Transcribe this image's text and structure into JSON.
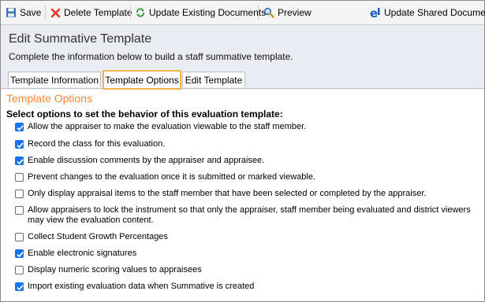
{
  "toolbar": {
    "save": "Save",
    "delete": "Delete Template",
    "update_docs": "Update Existing Documents",
    "preview": "Preview",
    "update_shared": "Update Shared Document"
  },
  "header": {
    "title": "Edit Summative Template",
    "subtitle": "Complete the information below to build a staff summative template."
  },
  "tabs": [
    {
      "label": "Template Information",
      "active": false
    },
    {
      "label": "Template Options",
      "active": true
    },
    {
      "label": "Edit Template",
      "active": false
    }
  ],
  "section": {
    "title": "Template Options",
    "instructions": "Select options to set the behavior of this evaluation template:"
  },
  "options": [
    {
      "label": "Allow the appraiser to make the evaluation viewable to the staff member.",
      "checked": true
    },
    {
      "label": "Record the class for this evaluation.",
      "checked": true
    },
    {
      "label": "Enable discussion comments by the appraiser and appraisee.",
      "checked": true
    },
    {
      "label": "Prevent changes to the evaluation once it is submitted or marked viewable.",
      "checked": false
    },
    {
      "label": "Only display appraisal items to the staff member that have been selected or completed by the appraiser.",
      "checked": false
    },
    {
      "label": "Allow appraisers to lock the instrument so that only the appraiser, staff member being evaluated and district viewers may view the evaluation content.",
      "checked": false
    },
    {
      "label": "Collect Student Growth Percentages",
      "checked": false
    },
    {
      "label": "Enable electronic signatures",
      "checked": true
    },
    {
      "label": "Display numeric scoring values to appraisees",
      "checked": false
    },
    {
      "label": "Import existing evaluation data when Summative is created",
      "checked": true
    }
  ],
  "colors": {
    "accent_tab_border": "#f0b44a",
    "section_title": "#f08a3c",
    "checkbox_checked": "#1a73e8"
  }
}
